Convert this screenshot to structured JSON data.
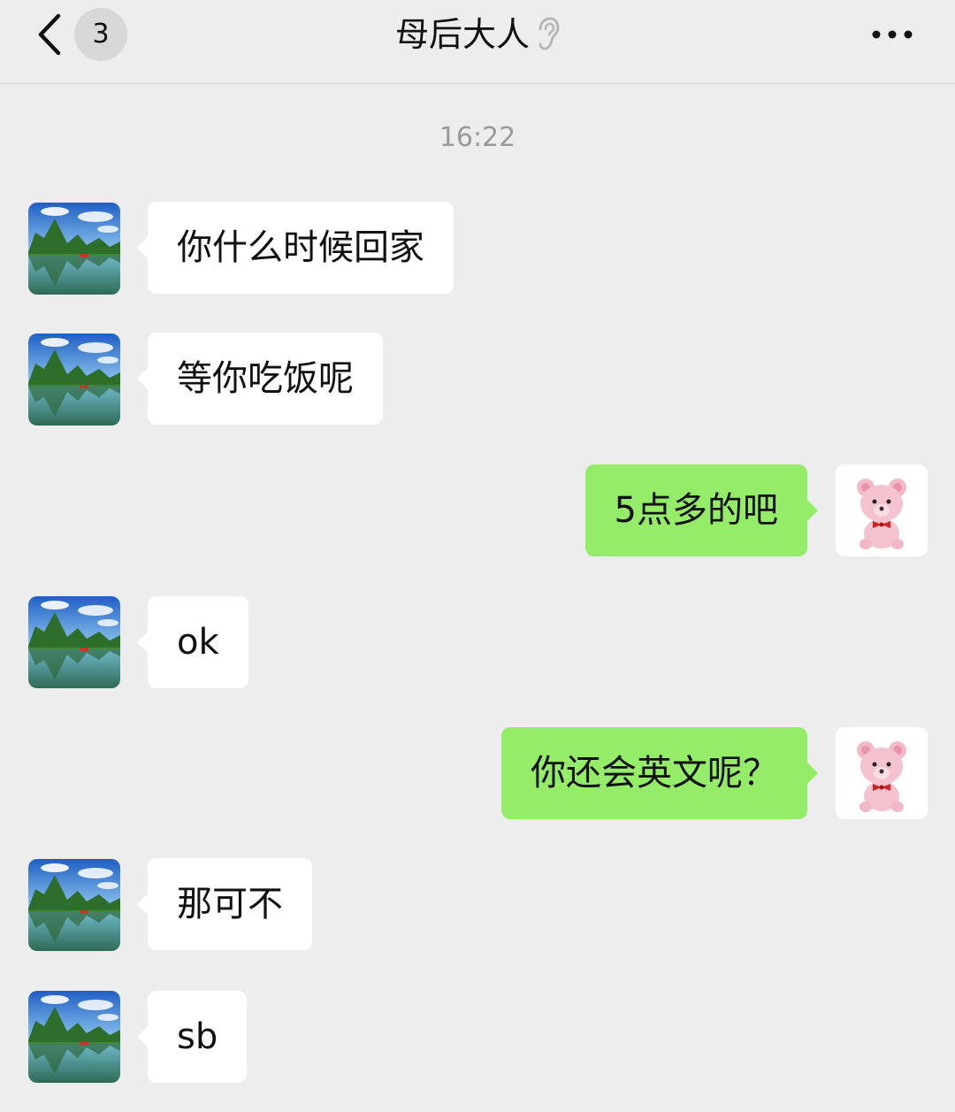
{
  "header": {
    "unread_count": "3",
    "title": "母后大人",
    "icons": {
      "back": "chevron-left-icon",
      "earpiece_mode": "ear-icon",
      "more": "more-dots-icon"
    }
  },
  "chat": {
    "timestamp": "16:22",
    "messages": [
      {
        "from": "contact",
        "text": "你什么时候回家"
      },
      {
        "from": "contact",
        "text": "等你吃饭呢"
      },
      {
        "from": "me",
        "text": "5点多的吧"
      },
      {
        "from": "contact",
        "text": "ok"
      },
      {
        "from": "me",
        "text": "你还会英文呢？"
      },
      {
        "from": "contact",
        "text": "那可不"
      },
      {
        "from": "contact",
        "text": "sb"
      }
    ]
  },
  "colors": {
    "background": "#ededed",
    "incoming_bubble": "#ffffff",
    "outgoing_bubble": "#95ec69",
    "timestamp_text": "#9a9a9a"
  }
}
